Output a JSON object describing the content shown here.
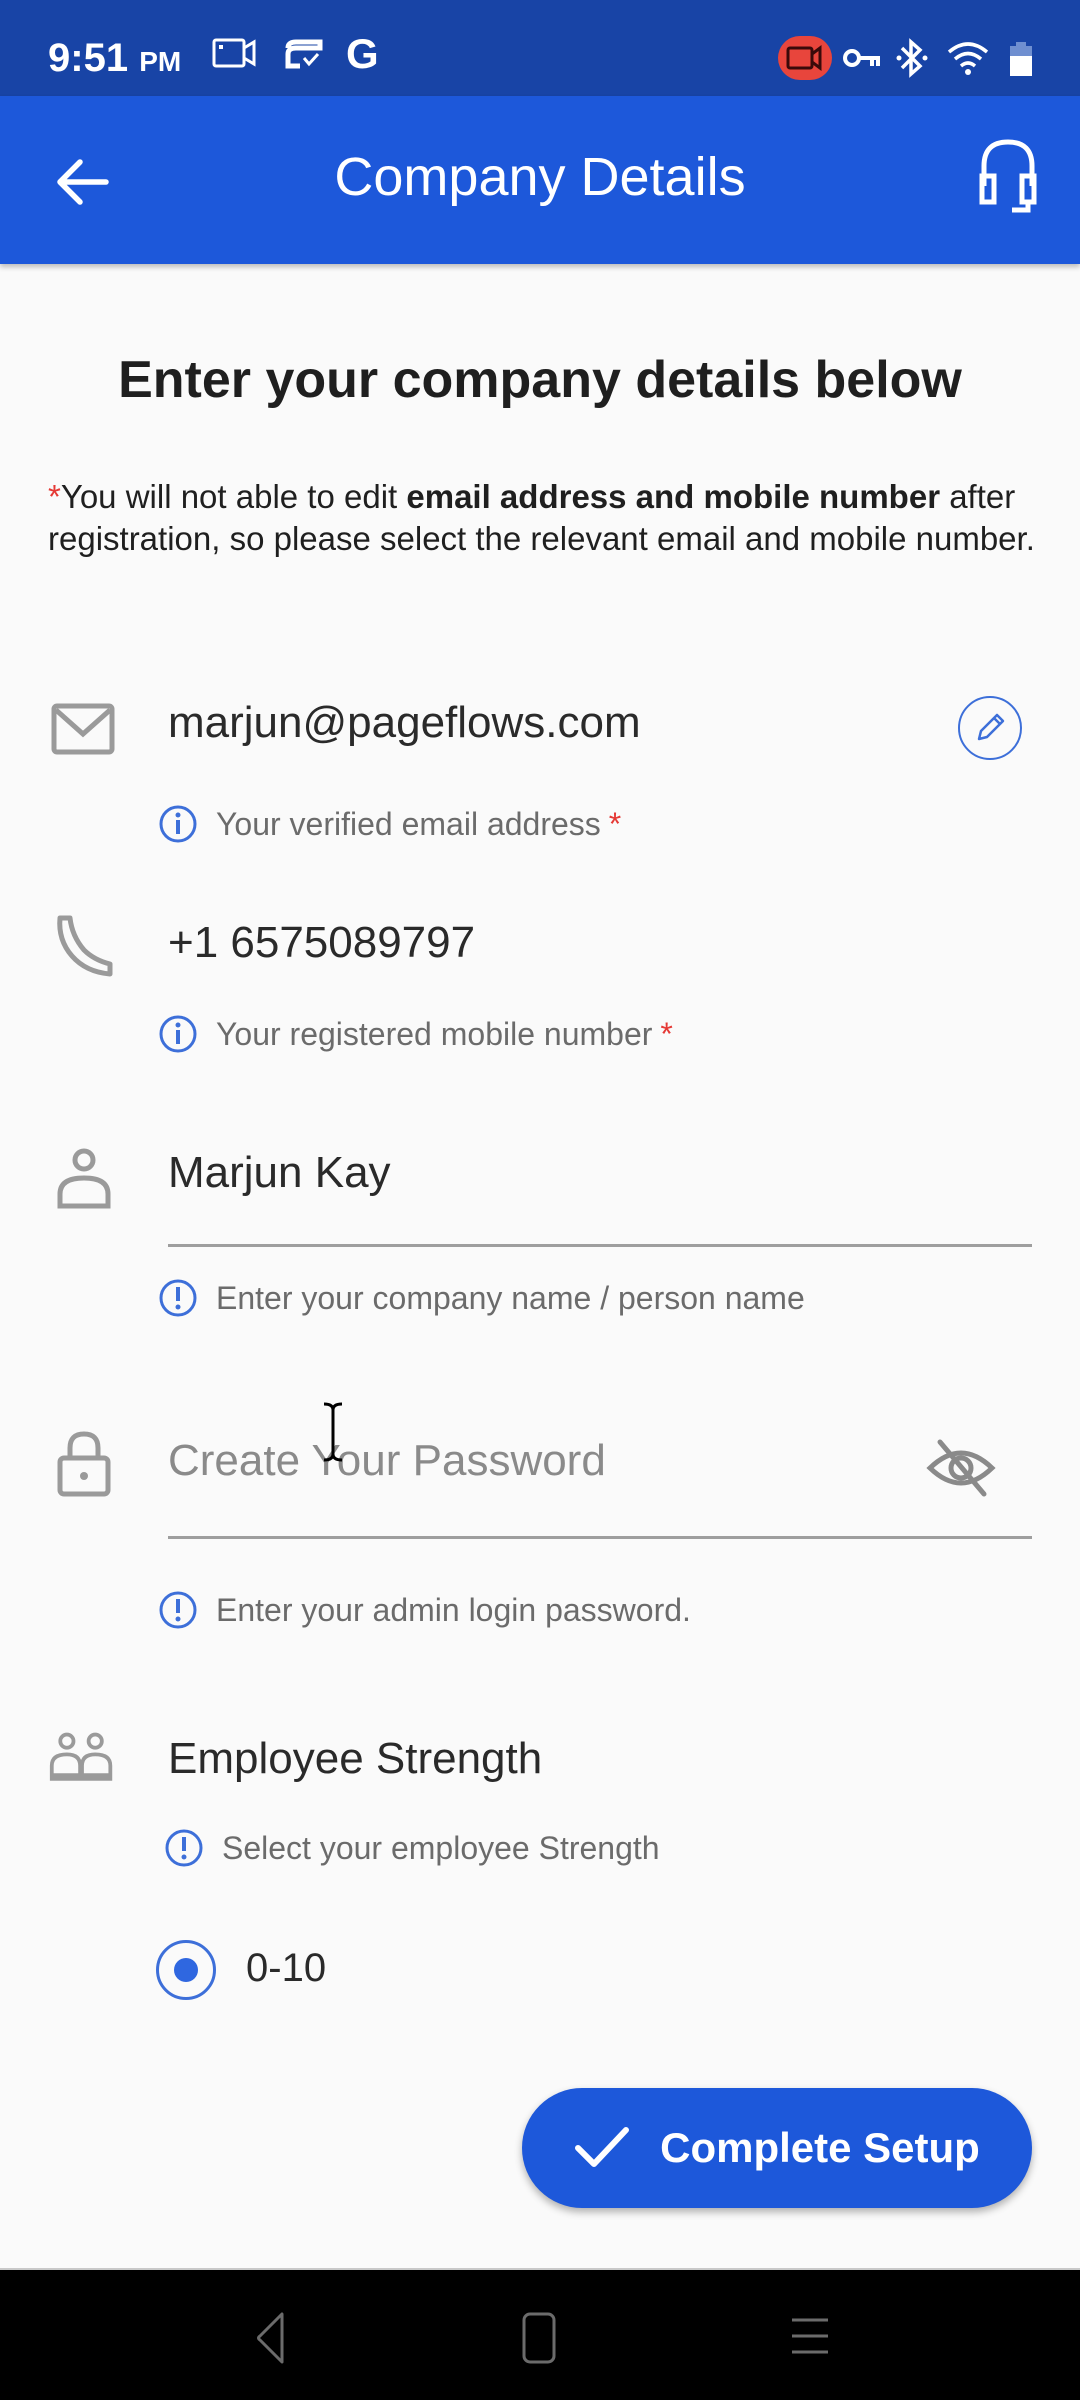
{
  "status_bar": {
    "time": "9:51",
    "ampm": "PM",
    "left_icons": [
      "screen-record-icon",
      "sync-check-icon",
      "google-icon"
    ],
    "right_icons": [
      "recording-active-icon",
      "vpn-key-icon",
      "bluetooth-icon",
      "wifi-icon",
      "battery-icon"
    ],
    "recording_color": "#e8453c"
  },
  "app_bar": {
    "title": "Company Details",
    "back_icon": "arrow-left-icon",
    "support_icon": "headset-icon",
    "color": "#1d58da"
  },
  "form": {
    "heading": "Enter your company details below",
    "notice": {
      "asterisk": "*",
      "prefix": "You will not able to edit ",
      "bold": "email address and mobile number",
      "suffix": " after registration, so please select the relevant email and mobile number."
    },
    "email": {
      "icon": "mail-icon",
      "value": "marjun@pageflows.com",
      "hint": "Your verified email address",
      "required_mark": "*",
      "edit_icon": "pencil-icon"
    },
    "phone": {
      "icon": "phone-icon",
      "value": "+1 6575089797",
      "hint": "Your registered mobile number",
      "required_mark": "*"
    },
    "name": {
      "icon": "person-icon",
      "value": "Marjun Kay",
      "hint": "Enter your company name / person name"
    },
    "password": {
      "icon": "lock-icon",
      "value": "",
      "placeholder": "Create Your Password",
      "hint": "Enter your admin login password.",
      "visibility_icon": "eye-off-icon"
    },
    "employee_strength": {
      "icon": "group-icon",
      "label": "Employee Strength",
      "hint": "Select your employee Strength",
      "options": [
        {
          "label": "0-10",
          "selected": true
        }
      ]
    },
    "submit_label": "Complete Setup",
    "accent_color": "#3d6fd9"
  },
  "nav_bar": {
    "buttons": [
      "back-nav-icon",
      "home-nav-icon",
      "recents-nav-icon"
    ]
  }
}
